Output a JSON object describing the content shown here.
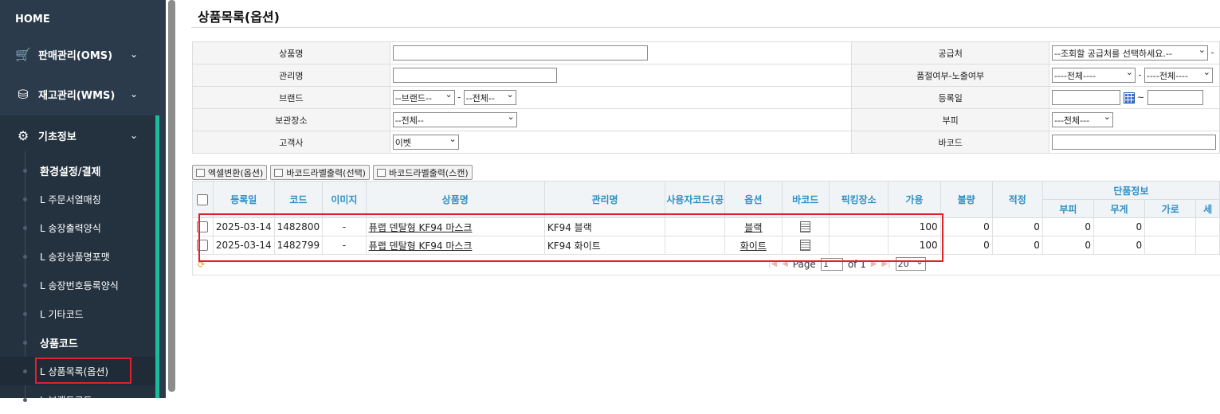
{
  "sidebar": {
    "home": "HOME",
    "menus": [
      {
        "label": "판매관리(OMS)",
        "icon": "cart-icon"
      },
      {
        "label": "재고관리(WMS)",
        "icon": "boxes-icon"
      },
      {
        "label": "기초정보",
        "icon": "gear-icon"
      }
    ],
    "subs": [
      {
        "label": "환경설정/결제",
        "bold": true
      },
      {
        "label": "L 주문서열매칭",
        "bold": false
      },
      {
        "label": "L 송장출력양식",
        "bold": false
      },
      {
        "label": "L 송장상품명포맷",
        "bold": false
      },
      {
        "label": "L 송장번호등록양식",
        "bold": false
      },
      {
        "label": "L 기타코드",
        "bold": false
      },
      {
        "label": "상품코드",
        "bold": true
      },
      {
        "label": "L 상품목록(옵션)",
        "bold": false
      },
      {
        "label": "L 브랜드코드",
        "bold": false
      }
    ]
  },
  "page": {
    "title": "상품목록(옵션)"
  },
  "search": {
    "product_name_label": "상품명",
    "manage_name_label": "관리명",
    "brand_label": "브랜드",
    "brand_select": "--브랜드--",
    "brand_all": "--전체--",
    "storage_label": "보관장소",
    "storage_select": "--전체--",
    "customer_label": "고객사",
    "customer_select": "이벳",
    "supplier_label": "공급처",
    "supplier_select": "--조회할 공급처를 선택하세요.--",
    "soldout_label": "품절여부-노출여부",
    "soldout_select": "----전체----",
    "exposure_select": "----전체----",
    "regdate_label": "등록일",
    "date_sep": "~",
    "volume_label": "부피",
    "volume_select": "---전체---",
    "barcode_label": "바코드"
  },
  "buttons": {
    "excel": "엑셀변환(옵션)",
    "barcode_selected": "바코드라벨출력(선택)",
    "barcode_scan": "바코드라벨출력(스캔)"
  },
  "grid": {
    "headers": {
      "regdate": "등록일",
      "code": "코드",
      "image": "이미지",
      "name": "상품명",
      "manage": "관리명",
      "usercode": "사용자코드(공",
      "option": "옵션",
      "barcode": "바코드",
      "picking": "픽킹장소",
      "avail": "가용",
      "defect": "불량",
      "proper": "적정",
      "unit": "단품정보",
      "volume": "부피",
      "weight": "무게",
      "width": "가로",
      "length": "세"
    },
    "rows": [
      {
        "regdate": "2025-03-14",
        "code": "1482800",
        "image": "-",
        "name": "퓨랩 덴탈형 KF94 마스크",
        "manage": "KF94 블랙",
        "usercode": "",
        "option": "블랙",
        "picking": "",
        "avail": "100",
        "defect": "0",
        "proper": "0",
        "volume": "0",
        "weight": "0",
        "width": ""
      },
      {
        "regdate": "2025-03-14",
        "code": "1482799",
        "image": "-",
        "name": "퓨랩 덴탈형 KF94 마스크",
        "manage": "KF94 화이트",
        "usercode": "",
        "option": "화이트",
        "picking": "",
        "avail": "100",
        "defect": "0",
        "proper": "0",
        "volume": "0",
        "weight": "0",
        "width": ""
      }
    ]
  },
  "pager": {
    "page_label": "Page",
    "page_value": "1",
    "of_label": "of 1",
    "per_page": "20"
  }
}
